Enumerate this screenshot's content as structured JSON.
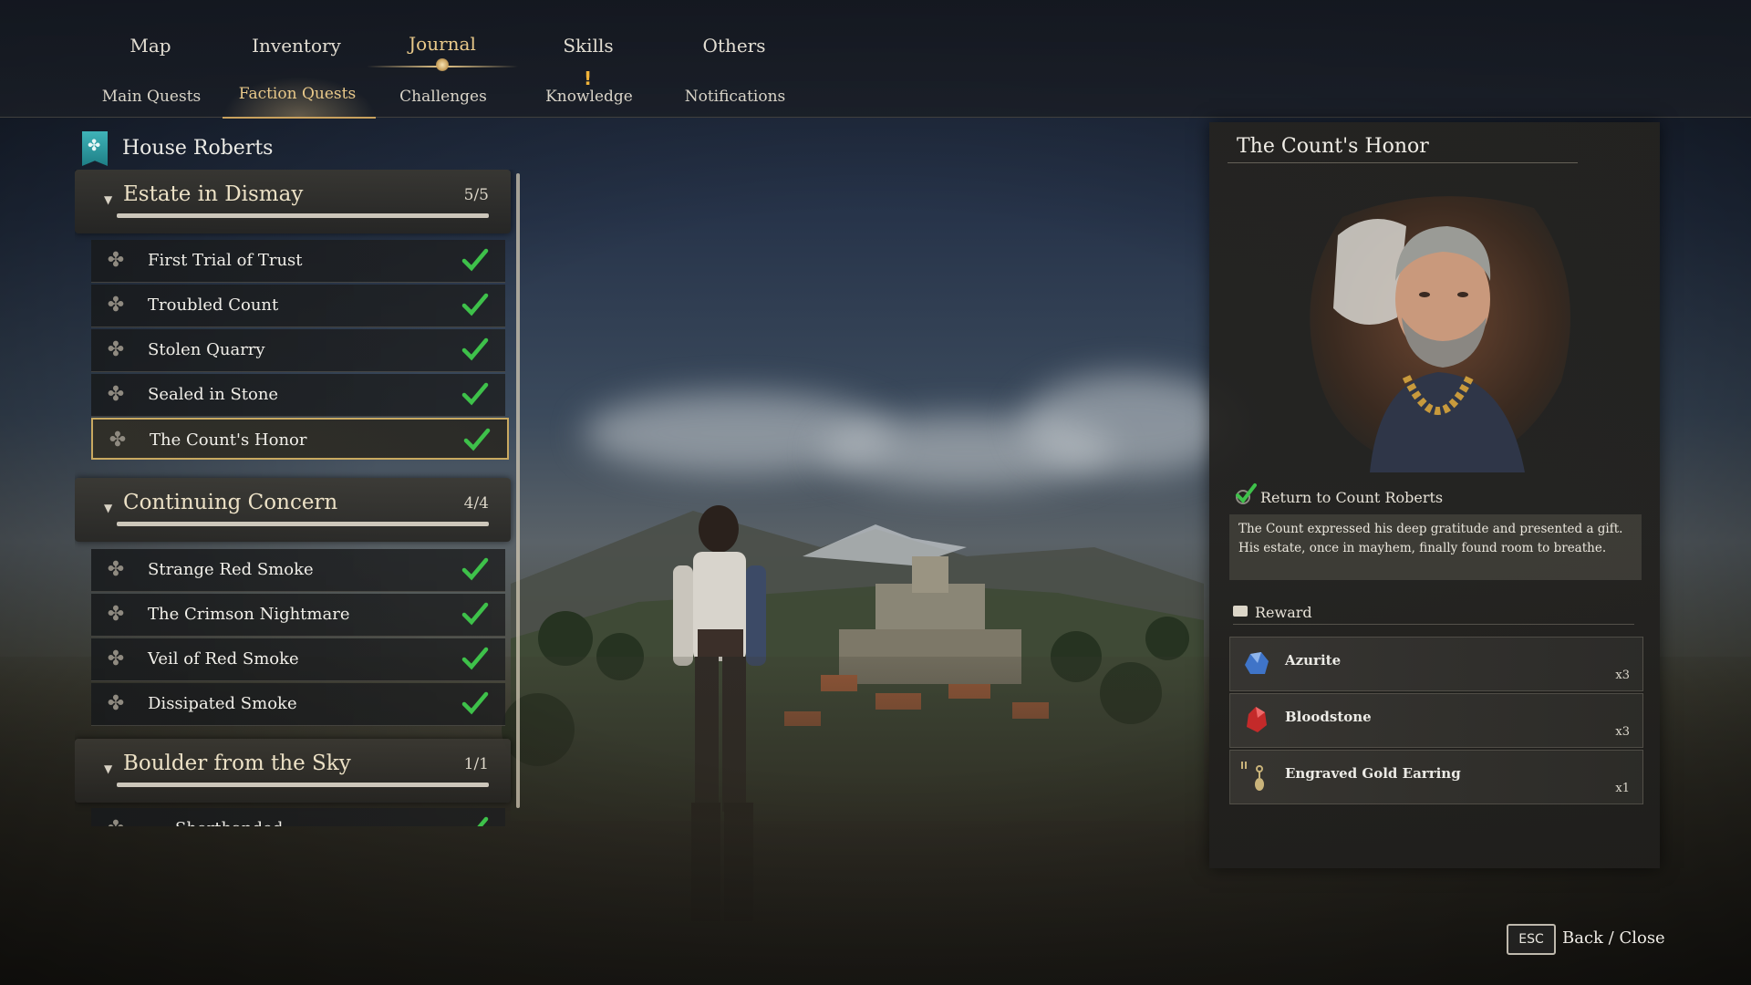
{
  "nav": {
    "tabs": [
      "Map",
      "Inventory",
      "Journal",
      "Skills",
      "Others"
    ],
    "active_tab": "Journal",
    "subtabs": [
      "Main Quests",
      "Faction Quests",
      "Challenges",
      "Knowledge",
      "Notifications"
    ],
    "active_subtab": "Faction Quests",
    "knowledge_alert": "!"
  },
  "faction": {
    "name": "House Roberts",
    "icon": "faction-crest-icon"
  },
  "groups": [
    {
      "title": "Estate in Dismay",
      "count": "5/5",
      "quests": [
        "First Trial of Trust",
        "Troubled Count",
        "Stolen Quarry",
        "Sealed in Stone",
        "The Count's Honor"
      ]
    },
    {
      "title": "Continuing Concern",
      "count": "4/4",
      "quests": [
        "Strange Red Smoke",
        "The Crimson Nightmare",
        "Veil of Red Smoke",
        "Dissipated Smoke"
      ]
    },
    {
      "title": "Boulder from the Sky",
      "count": "1/1",
      "quests": [
        "Shorthanded"
      ]
    }
  ],
  "selected_quest": "The Count's Honor",
  "detail": {
    "title": "The Count's Honor",
    "objective": "Return to Count Roberts",
    "description": "The Count expressed his deep gratitude and presented a gift. His estate, once in mayhem, finally found room to breathe.",
    "reward_header": "Reward",
    "rewards": [
      {
        "name": "Azurite",
        "qty": "x3",
        "color": "#3f74c8"
      },
      {
        "name": "Bloodstone",
        "qty": "x3",
        "color": "#c42a2a"
      },
      {
        "name": "Engraved Gold Earring",
        "qty": "x1",
        "color": "#c9b37a"
      }
    ]
  },
  "footer": {
    "key": "ESC",
    "label": "Back / Close"
  },
  "colors": {
    "accent_gold": "#e9c98a",
    "check_green": "#3ec14a"
  }
}
